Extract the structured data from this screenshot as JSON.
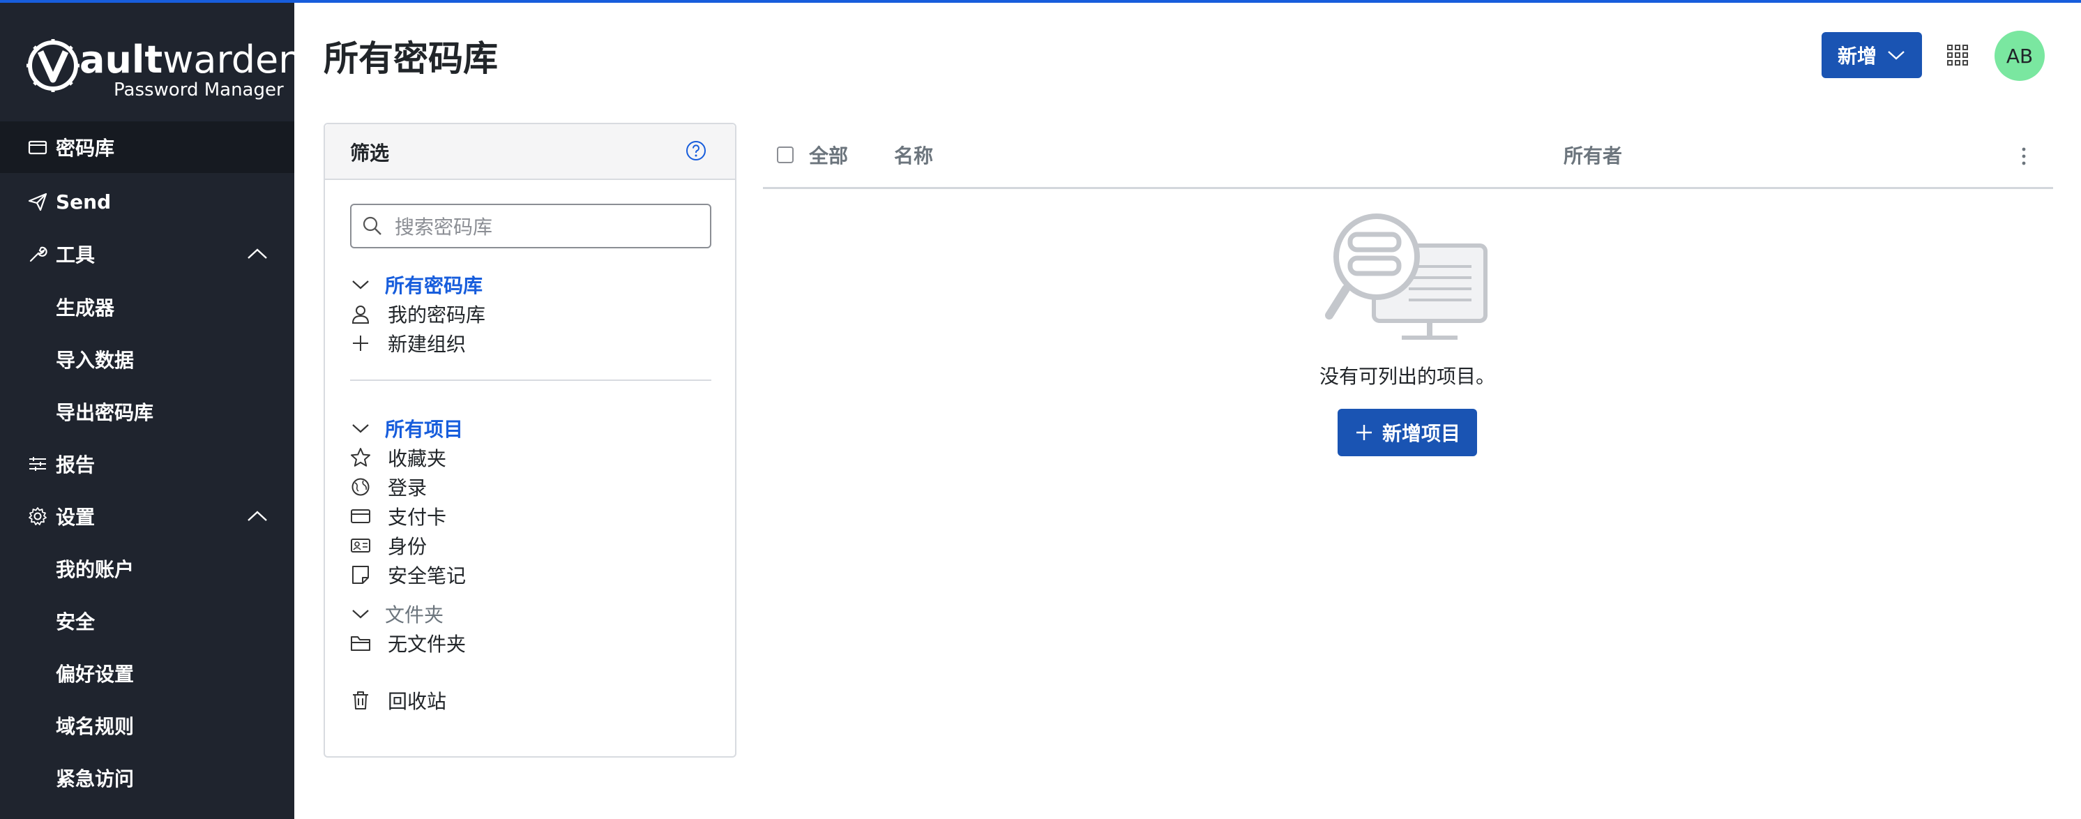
{
  "brand": {
    "name_bold": "ault",
    "name_regular": "warden",
    "subtitle": "Password Manager"
  },
  "sidebar": {
    "items": [
      {
        "label": "密码库",
        "icon": "vault-icon",
        "active": true
      },
      {
        "label": "Send",
        "icon": "paper-plane-icon"
      },
      {
        "label": "工具",
        "icon": "wrench-icon",
        "expanded": true
      },
      {
        "label": "生成器",
        "sub": true
      },
      {
        "label": "导入数据",
        "sub": true
      },
      {
        "label": "导出密码库",
        "sub": true
      },
      {
        "label": "报告",
        "icon": "sliders-icon"
      },
      {
        "label": "设置",
        "icon": "gear-icon",
        "expanded": true
      },
      {
        "label": "我的账户",
        "sub": true
      },
      {
        "label": "安全",
        "sub": true
      },
      {
        "label": "偏好设置",
        "sub": true
      },
      {
        "label": "域名规则",
        "sub": true
      },
      {
        "label": "紧急访问",
        "sub": true
      }
    ]
  },
  "header": {
    "title": "所有密码库",
    "new_button": "新增",
    "avatar_initials": "AB"
  },
  "filter": {
    "title": "筛选",
    "search_placeholder": "搜索密码库",
    "vaults_group": "所有密码库",
    "vaults": [
      "我的密码库",
      "新建组织"
    ],
    "items_group": "所有项目",
    "types": [
      "收藏夹",
      "登录",
      "支付卡",
      "身份",
      "安全笔记"
    ],
    "folders_group": "文件夹",
    "folders": [
      "无文件夹"
    ],
    "trash": "回收站"
  },
  "table": {
    "select_all": "全部",
    "col_name": "名称",
    "col_owner": "所有者",
    "empty_message": "没有可列出的项目。",
    "add_item_button": "新增项目"
  },
  "colors": {
    "sidebar_bg": "#1f242e",
    "primary": "#1a54b3",
    "link": "#175ddc",
    "avatar": "#7ae7a0"
  }
}
